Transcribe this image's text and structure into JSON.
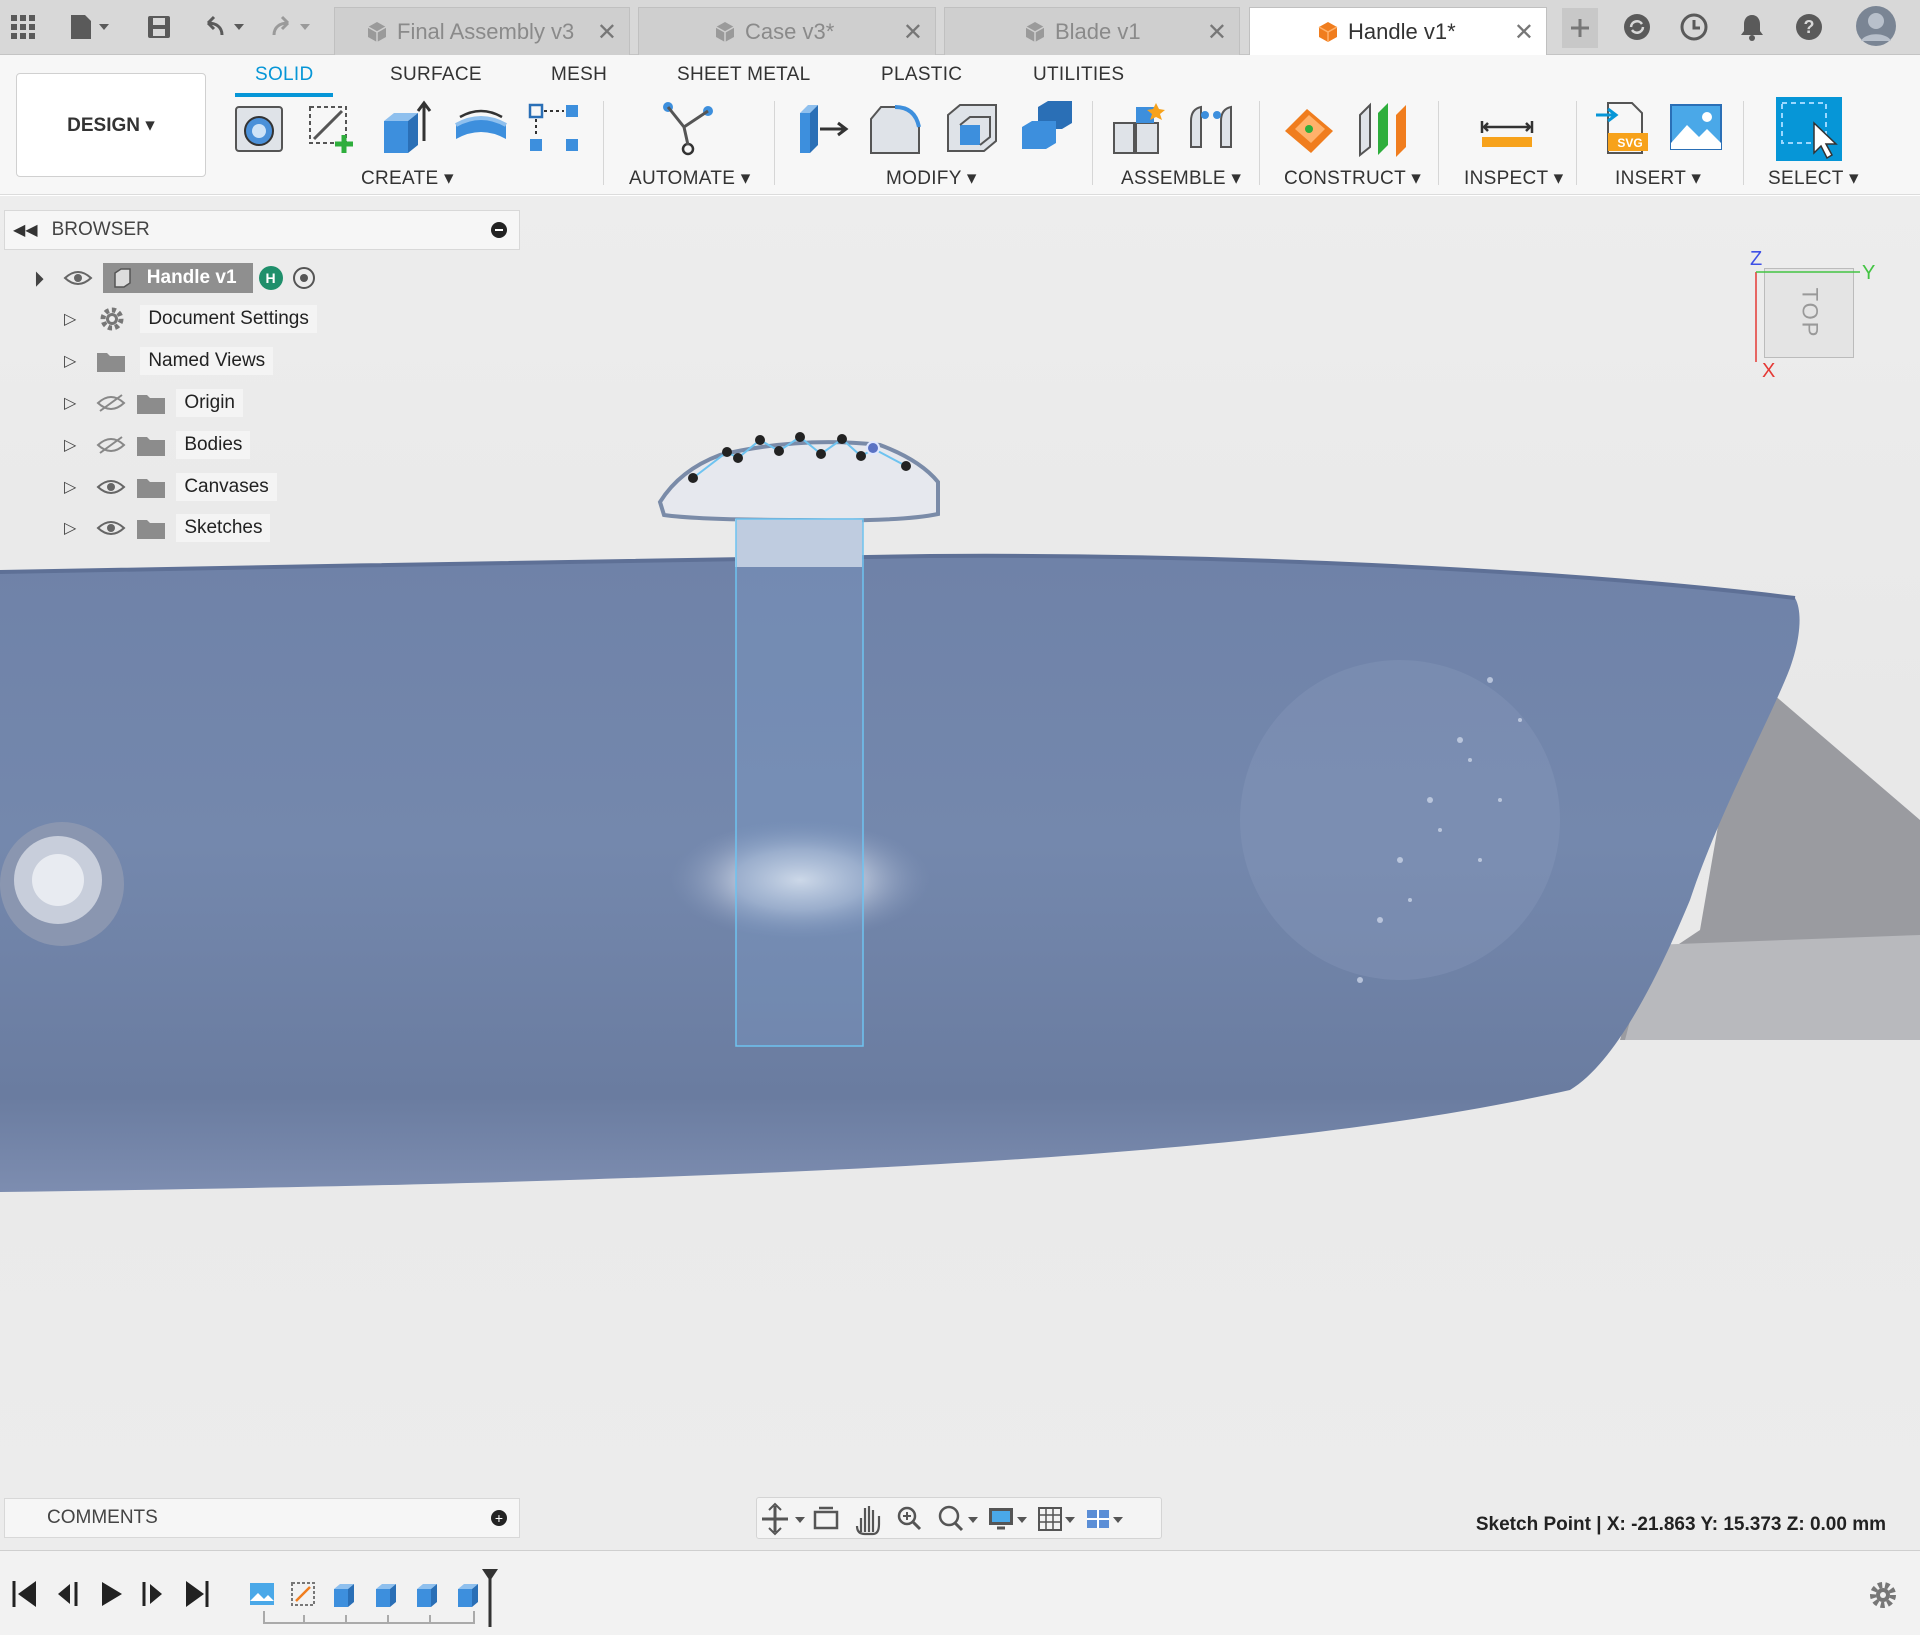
{
  "tabs": [
    {
      "label": "Final Assembly v3"
    },
    {
      "label": "Case v3*"
    },
    {
      "label": "Blade v1"
    },
    {
      "label": "Handle v1*"
    }
  ],
  "ribbon": {
    "design_label": "DESIGN ▾",
    "tabs": [
      "SOLID",
      "SURFACE",
      "MESH",
      "SHEET METAL",
      "PLASTIC",
      "UTILITIES"
    ],
    "groups": [
      "CREATE ▾",
      "AUTOMATE ▾",
      "MODIFY ▾",
      "ASSEMBLE ▾",
      "CONSTRUCT ▾",
      "INSPECT ▾",
      "INSERT ▾",
      "SELECT ▾"
    ]
  },
  "browser": {
    "title": "BROWSER",
    "root": {
      "label": "Handle v1",
      "badge": "H"
    },
    "items": [
      {
        "label": "Document Settings",
        "icon": "gear-icon",
        "eye": "none"
      },
      {
        "label": "Named Views",
        "icon": "folder-icon",
        "eye": "none"
      },
      {
        "label": "Origin",
        "icon": "folder-icon",
        "eye": "hidden"
      },
      {
        "label": "Bodies",
        "icon": "folder-icon",
        "eye": "hidden"
      },
      {
        "label": "Canvases",
        "icon": "folder-icon",
        "eye": "visible"
      },
      {
        "label": "Sketches",
        "icon": "folder-icon",
        "eye": "visible"
      }
    ]
  },
  "viewcube": {
    "face": "TOP",
    "axis_z": "Z",
    "axis_y": "Y",
    "axis_x": "X"
  },
  "comments": {
    "title": "COMMENTS"
  },
  "status": {
    "text": "Sketch Point | X: -21.863 Y: 15.373 Z: 0.00 mm"
  },
  "colors": {
    "accent": "#0696d7",
    "handle_blue": "#6b80a6",
    "axis_x": "#e53935",
    "axis_y": "#43c443",
    "axis_z": "#3f51e6"
  }
}
